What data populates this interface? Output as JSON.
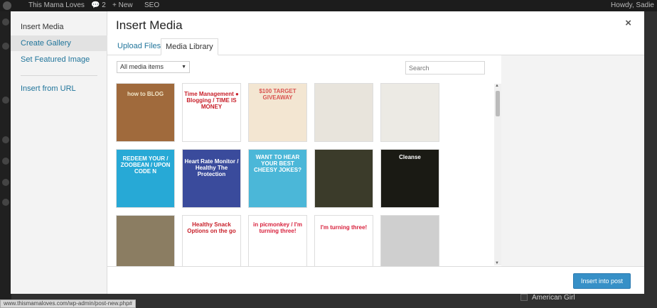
{
  "admin_bar": {
    "site_name": "This Mama Loves",
    "comments_count": "2",
    "new_label": "+ New",
    "seo_label": "SEO",
    "howdy": "Howdy, Sadie"
  },
  "background": {
    "checkbox_label": "American Girl",
    "status_url": "www.thismamaloves.com/wp-admin/post-new.php#"
  },
  "modal": {
    "sidebar": {
      "items": [
        {
          "label": "Insert Media"
        },
        {
          "label": "Create Gallery"
        },
        {
          "label": "Set Featured Image"
        },
        {
          "label": "Insert from URL"
        }
      ]
    },
    "title": "Insert Media",
    "close_glyph": "×",
    "tabs": [
      {
        "label": "Upload Files"
      },
      {
        "label": "Media Library"
      }
    ],
    "filter": {
      "selected": "All media items"
    },
    "search": {
      "placeholder": "Search"
    },
    "thumbnails": [
      {
        "text": "how to BLOG",
        "bg": "#a06a3c",
        "fg": "#f1e6c8"
      },
      {
        "text": "Time Management ● Blogging / TIME IS MONEY",
        "bg": "#ffffff",
        "fg": "#c8202a"
      },
      {
        "text": "$100 TARGET GIVEAWAY",
        "bg": "#f3e6d2",
        "fg": "#d9534f"
      },
      {
        "text": "",
        "bg": "#e8e4dc",
        "fg": "#333"
      },
      {
        "text": "",
        "bg": "#eceae4",
        "fg": "#333"
      },
      {
        "text": "REDEEM YOUR / ZOOBEAN / UPON CODE N",
        "bg": "#27a9d6",
        "fg": "#ffffff"
      },
      {
        "text": "Heart Rate Monitor / Healthy The Protection",
        "bg": "#3a4b9c",
        "fg": "#ffffff"
      },
      {
        "text": "WANT TO HEAR YOUR BEST CHEESY JOKES?",
        "bg": "#4bb7d8",
        "fg": "#ffffff"
      },
      {
        "text": "",
        "bg": "#3b3b2a",
        "fg": "#fff"
      },
      {
        "text": "Cleanse",
        "bg": "#1a1a14",
        "fg": "#ffffff"
      },
      {
        "text": "",
        "bg": "#8b7d62",
        "fg": "#fff"
      },
      {
        "text": "Healthy Snack Options on the go",
        "bg": "#ffffff",
        "fg": "#c8202a"
      },
      {
        "text": "in picmonkey / I'm turning three!",
        "bg": "#ffffff",
        "fg": "#d81f3b"
      },
      {
        "text": "I'm turning three!",
        "bg": "#ffffff",
        "fg": "#d81f3b"
      },
      {
        "text": "",
        "bg": "#cfcfcf",
        "fg": "#d81f3b"
      }
    ],
    "insert_button": "Insert into post"
  },
  "colors": {
    "link": "#21759b",
    "primary_button": "#3790c7"
  }
}
